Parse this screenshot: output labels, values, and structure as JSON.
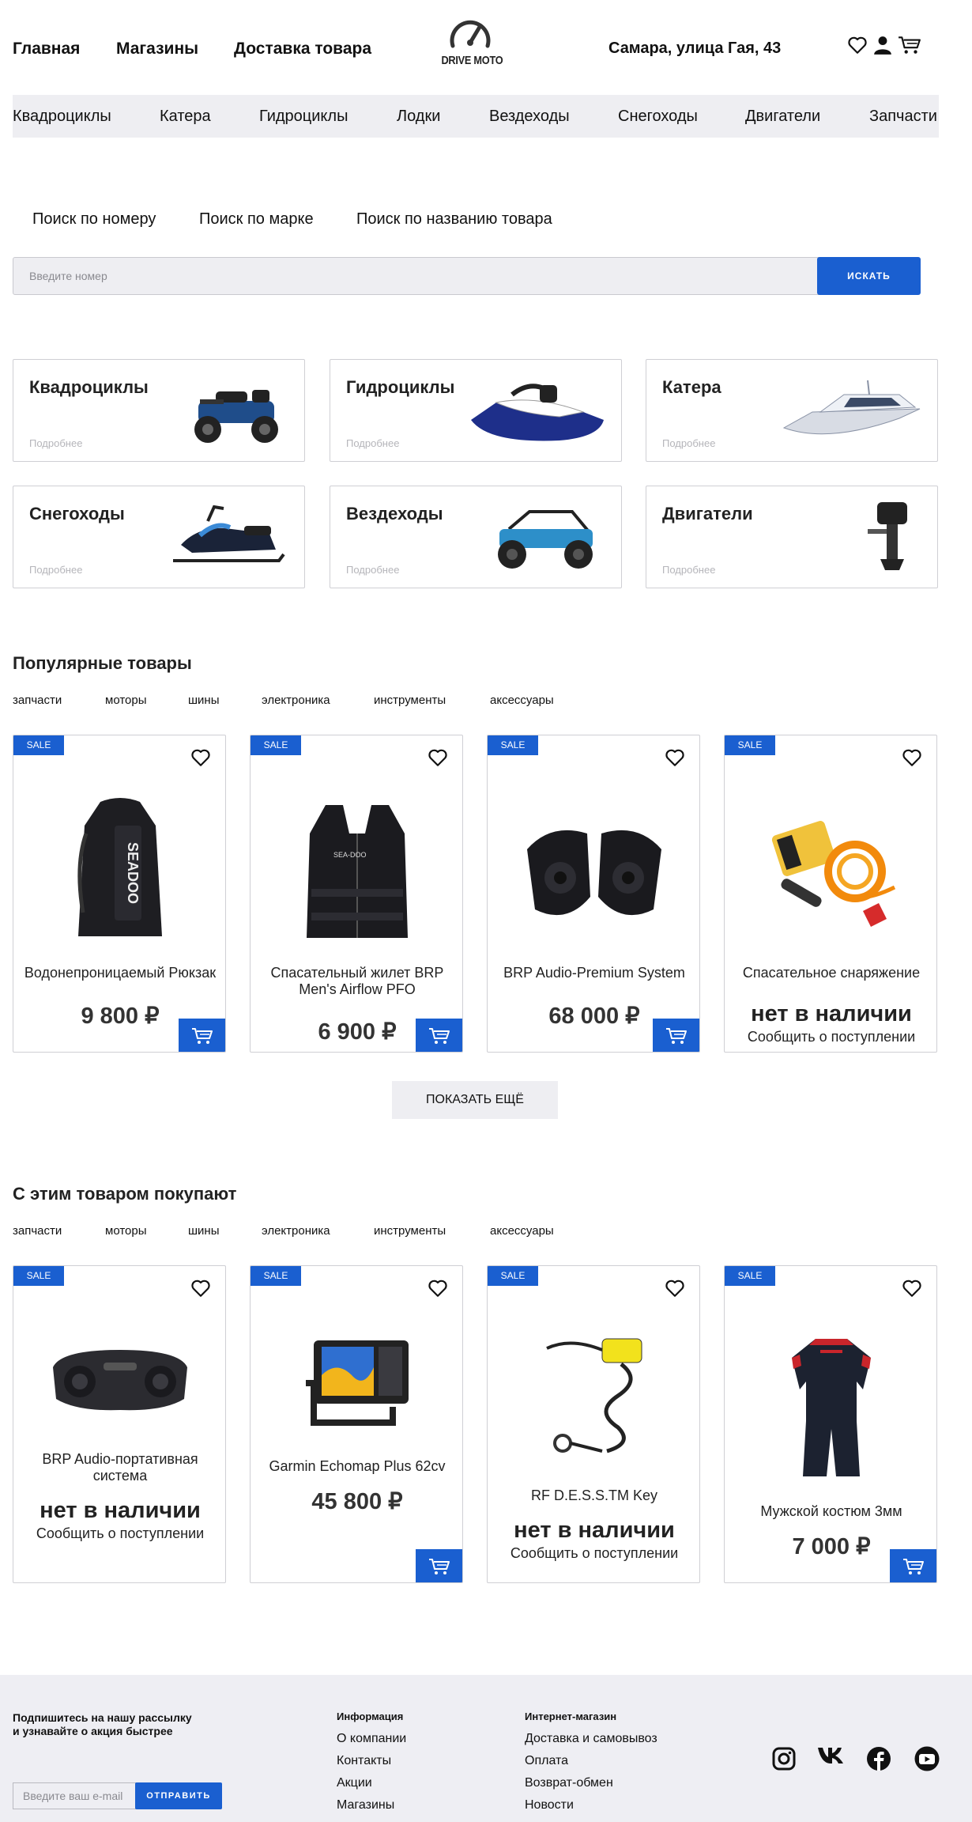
{
  "header": {
    "nav": [
      "Главная",
      "Магазины",
      "Доставка товара"
    ],
    "logo_text": "DRIVE MOTO",
    "address": "Самара, улица Гая, 43"
  },
  "categories_bar": [
    "Квадроциклы",
    "Катера",
    "Гидроциклы",
    "Лодки",
    "Вездеходы",
    "Снегоходы",
    "Двигатели",
    "Запчасти"
  ],
  "search": {
    "tabs": [
      "Поиск по номеру",
      "Поиск по марке",
      "Поиск по названию товара"
    ],
    "placeholder": "Введите номер",
    "button": "ИСКАТЬ"
  },
  "category_cards": [
    {
      "title": "Квадроциклы",
      "more": "Подробнее"
    },
    {
      "title": "Гидроциклы",
      "more": "Подробнее"
    },
    {
      "title": "Катера",
      "more": "Подробнее"
    },
    {
      "title": "Снегоходы",
      "more": "Подробнее"
    },
    {
      "title": "Вездеходы",
      "more": "Подробнее"
    },
    {
      "title": "Двигатели",
      "more": "Подробнее"
    }
  ],
  "popular": {
    "title": "Популярные товары",
    "filters": [
      "запчасти",
      "моторы",
      "шины",
      "электроника",
      "инструменты",
      "аксессуары"
    ],
    "products": [
      {
        "badge": "SALE",
        "name": "Водонепроницаемый Рюкзак",
        "price": "9 800 ₽"
      },
      {
        "badge": "SALE",
        "name": "Спасательный жилет BRP Men's Airflow PFO",
        "price": "6 900 ₽"
      },
      {
        "badge": "SALE",
        "name": "BRP Audio-Premium System",
        "price": "68 000 ₽"
      },
      {
        "badge": "SALE",
        "name": "Спасательное снаряжение",
        "out": "нет в наличии",
        "notify": "Сообщить о поступлении"
      }
    ],
    "more_button": "ПОКАЗАТЬ ЕЩЁ"
  },
  "also_bought": {
    "title": "С этим товаром покупают",
    "filters": [
      "запчасти",
      "моторы",
      "шины",
      "электроника",
      "инструменты",
      "аксессуары"
    ],
    "products": [
      {
        "badge": "SALE",
        "name": "BRP Audio-портативная система",
        "out": "нет в наличии",
        "notify": "Сообщить о поступлении"
      },
      {
        "badge": "SALE",
        "name": "Garmin Echomap Plus 62cv",
        "price": "45 800 ₽"
      },
      {
        "badge": "SALE",
        "name": "RF D.E.S.S.TM Key",
        "out": "нет в наличии",
        "notify": "Сообщить о поступлении"
      },
      {
        "badge": "SALE",
        "name": "Мужской костюм 3мм",
        "price": "7 000 ₽"
      }
    ]
  },
  "footer": {
    "subscribe_text": "Подпишитесь на нашу рассылку и узнавайте о акция быстрее",
    "email_placeholder": "Введите ваш e-mail",
    "send_button": "ОТПРАВИТЬ",
    "info_title": "Информация",
    "info_links": [
      "О компании",
      "Контакты",
      "Акции",
      "Магазины"
    ],
    "shop_title": "Интернет-магазин",
    "shop_links": [
      "Доставка и самовывоз",
      "Оплата",
      "Возврат-обмен",
      "Новости"
    ],
    "social_icons": [
      "instagram-icon",
      "vk-icon",
      "facebook-icon",
      "youtube-icon"
    ]
  },
  "colors": {
    "accent": "#1a5fd0",
    "bar_bg": "#eeeef2",
    "footer_bg": "#eeeef3"
  }
}
